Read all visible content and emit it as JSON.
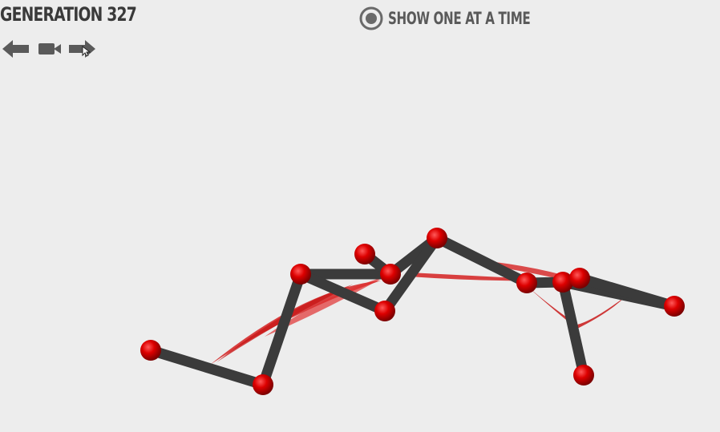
{
  "header": {
    "generation_label": "GENERATION 327",
    "show_one_label": "SHOW ONE AT A TIME",
    "show_one_checked": true
  },
  "controls": [
    {
      "name": "previous-button",
      "icon": "arrow-left-icon"
    },
    {
      "name": "camera-button",
      "icon": "camera-icon"
    },
    {
      "name": "next-button",
      "icon": "arrow-right-icon"
    }
  ],
  "colors": {
    "background": "#ededed",
    "text": "#3a3a3a",
    "bone": "#3b3b3b",
    "node": "#d40000",
    "muscle": "#d42020"
  }
}
